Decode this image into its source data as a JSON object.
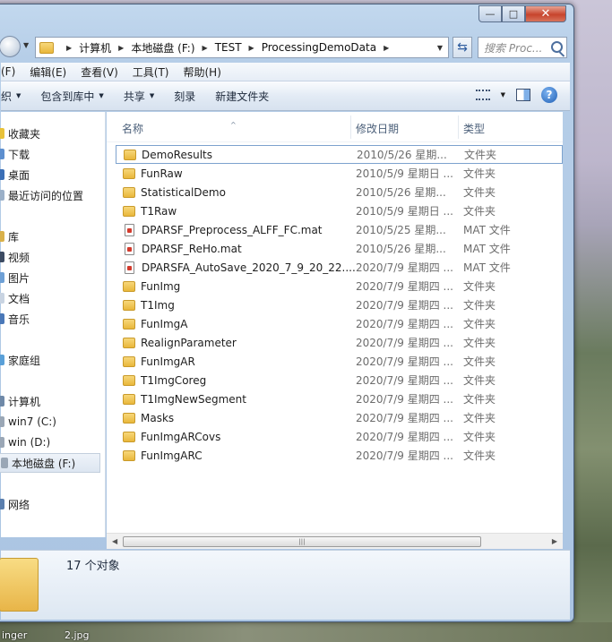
{
  "window": {
    "caption_min": "—",
    "caption_max": "□",
    "caption_close": "✕"
  },
  "address": {
    "crumbs": [
      "计算机",
      "本地磁盘 (F:)",
      "TEST",
      "ProcessingDemoData"
    ],
    "search_placeholder": "搜索 Proc..."
  },
  "menu": [
    "(F)",
    "编辑(E)",
    "查看(V)",
    "工具(T)",
    "帮助(H)"
  ],
  "toolbar": {
    "organize": "织",
    "include_library": "包含到库中",
    "share": "共享",
    "burn": "刻录",
    "new_folder": "新建文件夹"
  },
  "nav": {
    "favorites": "收藏夹",
    "downloads": "下载",
    "desktop": "桌面",
    "recent": "最近访问的位置",
    "libraries": "库",
    "videos": "视频",
    "pictures": "图片",
    "documents": "文档",
    "music": "音乐",
    "homegroup": "家庭组",
    "computer": "计算机",
    "drive_c": "win7 (C:)",
    "drive_d": "win (D:)",
    "drive_f": "本地磁盘 (F:)",
    "network": "网络"
  },
  "columns": {
    "name": "名称",
    "date": "修改日期",
    "type": "类型"
  },
  "files": [
    {
      "name": "DemoResults",
      "date": "2010/5/26 星期...",
      "type": "文件夹",
      "kind": "folder"
    },
    {
      "name": "FunRaw",
      "date": "2010/5/9 星期日 ...",
      "type": "文件夹",
      "kind": "folder"
    },
    {
      "name": "StatisticalDemo",
      "date": "2010/5/26 星期...",
      "type": "文件夹",
      "kind": "folder"
    },
    {
      "name": "T1Raw",
      "date": "2010/5/9 星期日 ...",
      "type": "文件夹",
      "kind": "folder"
    },
    {
      "name": "DPARSF_Preprocess_ALFF_FC.mat",
      "date": "2010/5/25 星期...",
      "type": "MAT 文件",
      "kind": "mat"
    },
    {
      "name": "DPARSF_ReHo.mat",
      "date": "2010/5/26 星期...",
      "type": "MAT 文件",
      "kind": "mat"
    },
    {
      "name": "DPARSFA_AutoSave_2020_7_9_20_22....",
      "date": "2020/7/9 星期四 ...",
      "type": "MAT 文件",
      "kind": "mat"
    },
    {
      "name": "FunImg",
      "date": "2020/7/9 星期四 ...",
      "type": "文件夹",
      "kind": "folder"
    },
    {
      "name": "T1Img",
      "date": "2020/7/9 星期四 ...",
      "type": "文件夹",
      "kind": "folder"
    },
    {
      "name": "FunImgA",
      "date": "2020/7/9 星期四 ...",
      "type": "文件夹",
      "kind": "folder"
    },
    {
      "name": "RealignParameter",
      "date": "2020/7/9 星期四 ...",
      "type": "文件夹",
      "kind": "folder"
    },
    {
      "name": "FunImgAR",
      "date": "2020/7/9 星期四 ...",
      "type": "文件夹",
      "kind": "folder"
    },
    {
      "name": "T1ImgCoreg",
      "date": "2020/7/9 星期四 ...",
      "type": "文件夹",
      "kind": "folder"
    },
    {
      "name": "T1ImgNewSegment",
      "date": "2020/7/9 星期四 ...",
      "type": "文件夹",
      "kind": "folder"
    },
    {
      "name": "Masks",
      "date": "2020/7/9 星期四 ...",
      "type": "文件夹",
      "kind": "folder"
    },
    {
      "name": "FunImgARCovs",
      "date": "2020/7/9 星期四 ...",
      "type": "文件夹",
      "kind": "folder"
    },
    {
      "name": "FunImgARC",
      "date": "2020/7/9 星期四 ...",
      "type": "文件夹",
      "kind": "folder"
    }
  ],
  "status": {
    "count": "17 个对象"
  },
  "desktop_labels": [
    "inger",
    "2.jpg"
  ]
}
